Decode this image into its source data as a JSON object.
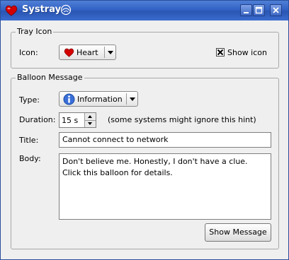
{
  "window": {
    "title": "Systray"
  },
  "tray_icon": {
    "group_title": "Tray Icon",
    "icon_label": "Icon:",
    "icon_value": "Heart",
    "icon_name": "heart-icon",
    "show_icon_label": "Show icon",
    "show_icon_checked": true
  },
  "balloon": {
    "group_title": "Balloon Message",
    "type_label": "Type:",
    "type_value": "Information",
    "type_icon_name": "information-icon",
    "duration_label": "Duration:",
    "duration_value": "15 s",
    "duration_hint": "(some systems might ignore this hint)",
    "title_label": "Title:",
    "title_value": "Cannot connect to network",
    "body_label": "Body:",
    "body_line1": "Don't believe me. Honestly, I don't have a clue.",
    "body_line2": "Click this balloon for details.",
    "show_message_label": "Show Message"
  },
  "colors": {
    "titlebar": "#3262c4",
    "heart": "#d40000",
    "info": "#3a6fd8"
  }
}
